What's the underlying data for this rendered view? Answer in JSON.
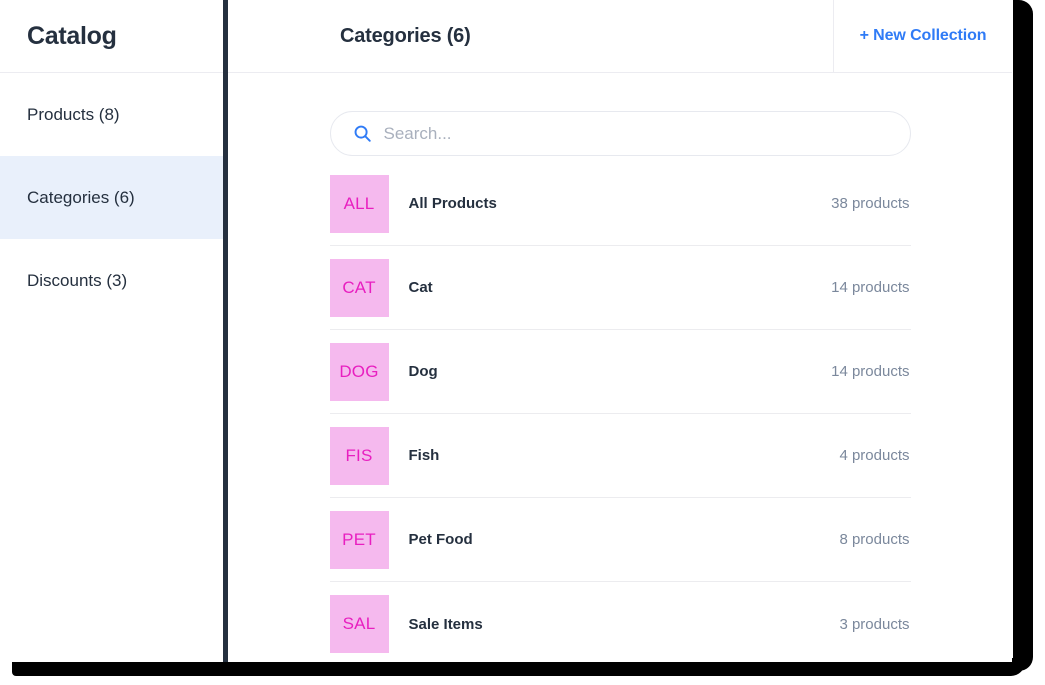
{
  "sidebar": {
    "title": "Catalog",
    "items": [
      {
        "label": "Products (8)",
        "active": false
      },
      {
        "label": "Categories  (6)",
        "active": true
      },
      {
        "label": "Discounts (3)",
        "active": false
      }
    ]
  },
  "header": {
    "title": "Categories (6)",
    "new_collection_label": "+ New Collection"
  },
  "search": {
    "placeholder": "Search...",
    "value": "",
    "icon": "search-icon"
  },
  "categories": [
    {
      "code": "ALL",
      "name": "All Products",
      "count": "38 products"
    },
    {
      "code": "CAT",
      "name": "Cat",
      "count": "14 products"
    },
    {
      "code": "DOG",
      "name": "Dog",
      "count": "14 products"
    },
    {
      "code": "FIS",
      "name": "Fish",
      "count": "4 products"
    },
    {
      "code": "PET",
      "name": "Pet Food",
      "count": "8 products"
    },
    {
      "code": "SAL",
      "name": "Sale Items",
      "count": "3 products"
    }
  ],
  "colors": {
    "accent_blue": "#2f7bf6",
    "thumb_bg": "#f5b9ee",
    "thumb_text": "#e81fc0",
    "active_nav_bg": "#e9f0fb",
    "text_dark": "#25303f",
    "text_muted": "#7b889c",
    "frame": "#000000",
    "divider": "#25303f"
  }
}
